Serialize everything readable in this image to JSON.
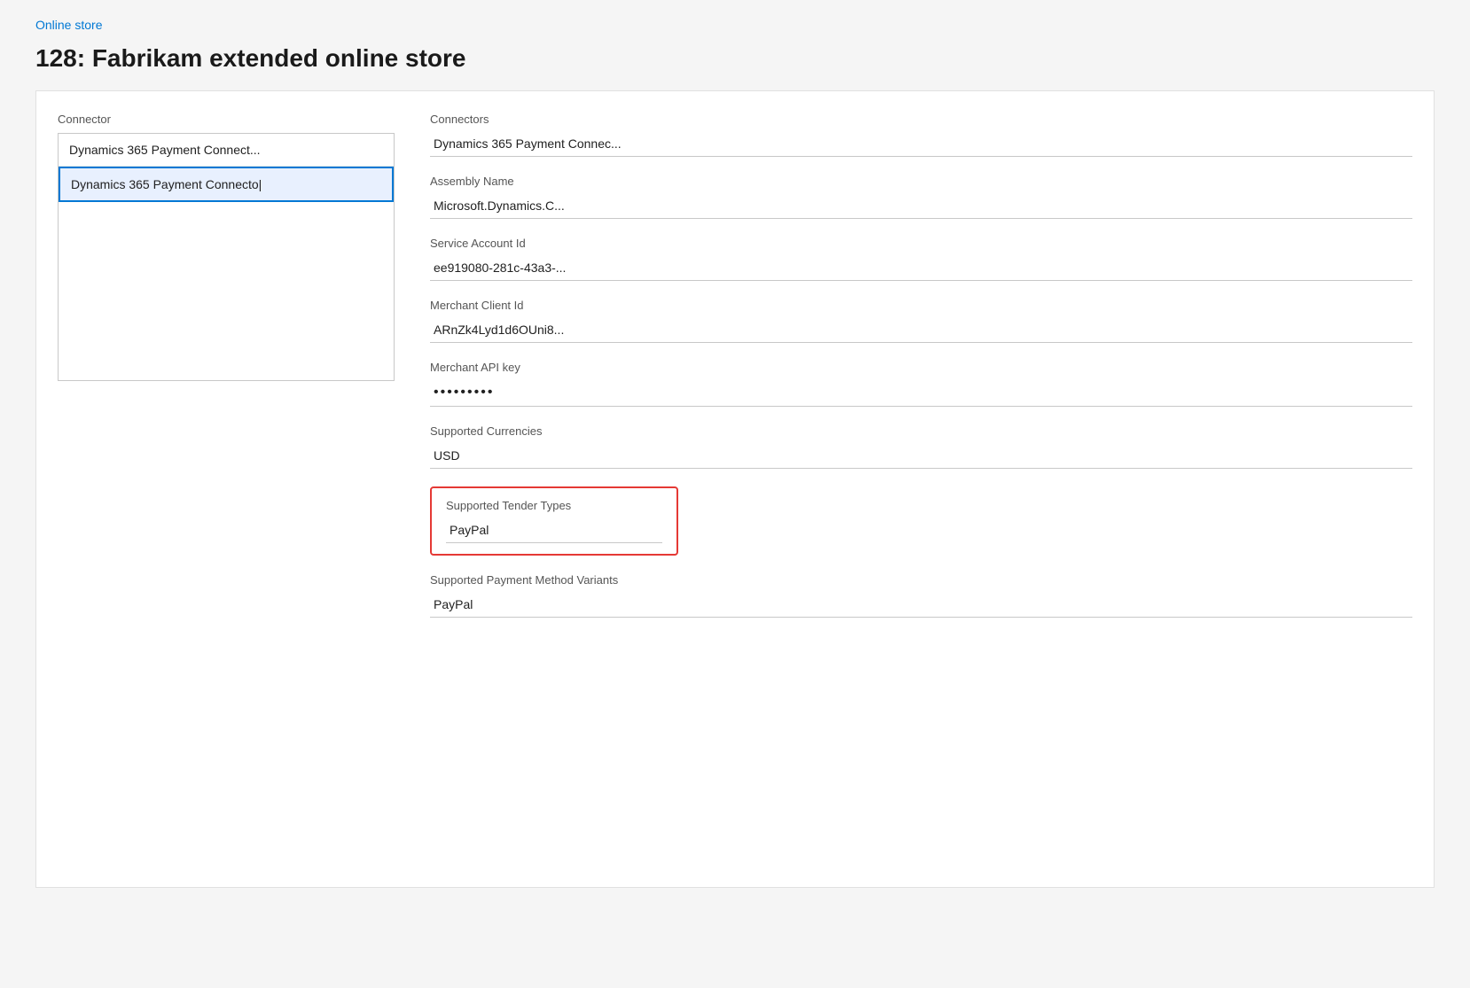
{
  "breadcrumb": {
    "label": "Online store",
    "href": "#"
  },
  "page_title": "128: Fabrikam extended online store",
  "left_panel": {
    "label": "Connector",
    "items": [
      {
        "id": "item-1",
        "text": "Dynamics 365 Payment Connect...",
        "selected": false
      },
      {
        "id": "item-2",
        "text": "Dynamics 365 Payment Connecto|",
        "selected": true
      }
    ]
  },
  "right_panel": {
    "fields": [
      {
        "id": "connectors",
        "label": "Connectors",
        "value": "Dynamics 365 Payment Connec...",
        "highlighted": false,
        "password": false
      },
      {
        "id": "assembly_name",
        "label": "Assembly Name",
        "value": "Microsoft.Dynamics.C...",
        "highlighted": false,
        "password": false
      },
      {
        "id": "service_account_id",
        "label": "Service Account Id",
        "value": "ee919080-281c-43a3-...",
        "highlighted": false,
        "password": false
      },
      {
        "id": "merchant_client_id",
        "label": "Merchant Client Id",
        "value": "ARnZk4Lyd1d6OUni8...",
        "highlighted": false,
        "password": false
      },
      {
        "id": "merchant_api_key",
        "label": "Merchant API key",
        "value": "•••••••••",
        "highlighted": false,
        "password": true
      },
      {
        "id": "supported_currencies",
        "label": "Supported Currencies",
        "value": "USD",
        "highlighted": false,
        "password": false
      },
      {
        "id": "supported_tender_types",
        "label": "Supported Tender Types",
        "value": "PayPal",
        "highlighted": true,
        "password": false
      },
      {
        "id": "supported_payment_method_variants",
        "label": "Supported Payment Method Variants",
        "value": "PayPal",
        "highlighted": false,
        "password": false
      }
    ]
  }
}
